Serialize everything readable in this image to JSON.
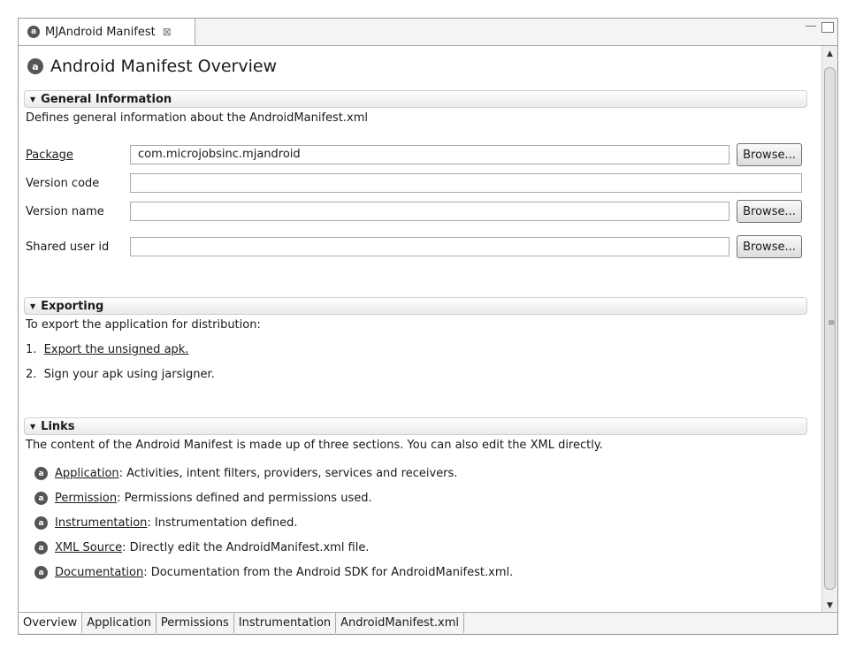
{
  "editor_tab": {
    "label": "MJAndroid Manifest",
    "close": "⊠"
  },
  "page_title": "Android Manifest Overview",
  "general": {
    "header": "General Information",
    "description": "Defines general information about the AndroidManifest.xml",
    "package_label": "Package",
    "package_value": "com.microjobsinc.mjandroid",
    "version_code_label": "Version code",
    "version_code_value": "",
    "version_name_label": "Version name",
    "version_name_value": "",
    "shared_user_label": "Shared user id",
    "shared_user_value": "",
    "browse_label": "Browse..."
  },
  "exporting": {
    "header": "Exporting",
    "description": "To export the application for distribution:",
    "step1_num": "1.",
    "step1_link": "Export the unsigned apk.",
    "step2_num": "2.",
    "step2_text": "Sign your apk using jarsigner."
  },
  "links": {
    "header": "Links",
    "description": "The content of the Android Manifest is made up of three sections. You can also edit the XML directly.",
    "items": [
      {
        "link": "Application",
        "text": ": Activities, intent filters, providers, services and receivers."
      },
      {
        "link": "Permission",
        "text": ": Permissions defined and permissions used."
      },
      {
        "link": "Instrumentation",
        "text": ": Instrumentation defined."
      },
      {
        "link": "XML Source",
        "text": ": Directly edit the AndroidManifest.xml file."
      },
      {
        "link": "Documentation",
        "text": ": Documentation from the Android SDK for AndroidManifest.xml."
      }
    ]
  },
  "bottom_tabs": [
    "Overview",
    "Application",
    "Permissions",
    "Instrumentation",
    "AndroidManifest.xml"
  ],
  "icons": {
    "android": "android-icon"
  }
}
